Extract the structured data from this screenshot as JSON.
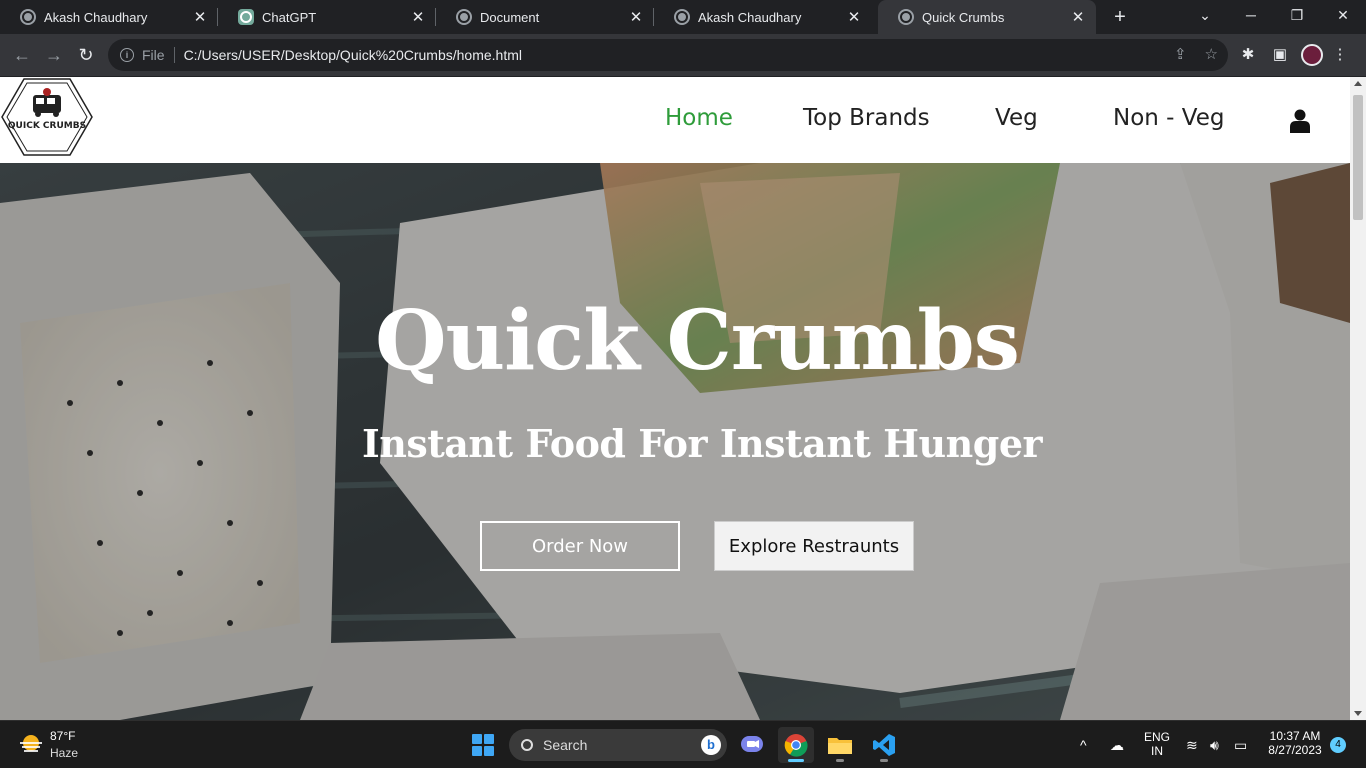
{
  "browser": {
    "tabs": [
      {
        "title": "Akash Chaudhary",
        "icon": "globe-icon"
      },
      {
        "title": "ChatGPT",
        "icon": "chatgpt-icon"
      },
      {
        "title": "Document",
        "icon": "globe-icon"
      },
      {
        "title": "Akash Chaudhary",
        "icon": "globe-icon"
      },
      {
        "title": "Quick Crumbs",
        "icon": "globe-icon",
        "active": true
      }
    ],
    "omnibox": {
      "scheme_label": "File",
      "url": "C:/Users/USER/Desktop/Quick%20Crumbs/home.html"
    }
  },
  "site": {
    "logo_text": "QUICK CRUMBS",
    "nav": {
      "links": [
        "Home",
        "Top Brands",
        "Veg",
        "Non - Veg"
      ],
      "active": "Home"
    },
    "hero": {
      "title": "Quick Crumbs",
      "subtitle": "Instant Food For Instant Hunger",
      "primary_button": "Order Now",
      "secondary_button": "Explore Restraunts"
    },
    "accent_color": "#2e9c3a"
  },
  "taskbar": {
    "weather": {
      "temp": "87°F",
      "condition": "Haze"
    },
    "search_placeholder": "Search",
    "language": {
      "line1": "ENG",
      "line2": "IN"
    },
    "clock": {
      "time": "10:37 AM",
      "date": "8/27/2023"
    },
    "notification_count": "4"
  }
}
